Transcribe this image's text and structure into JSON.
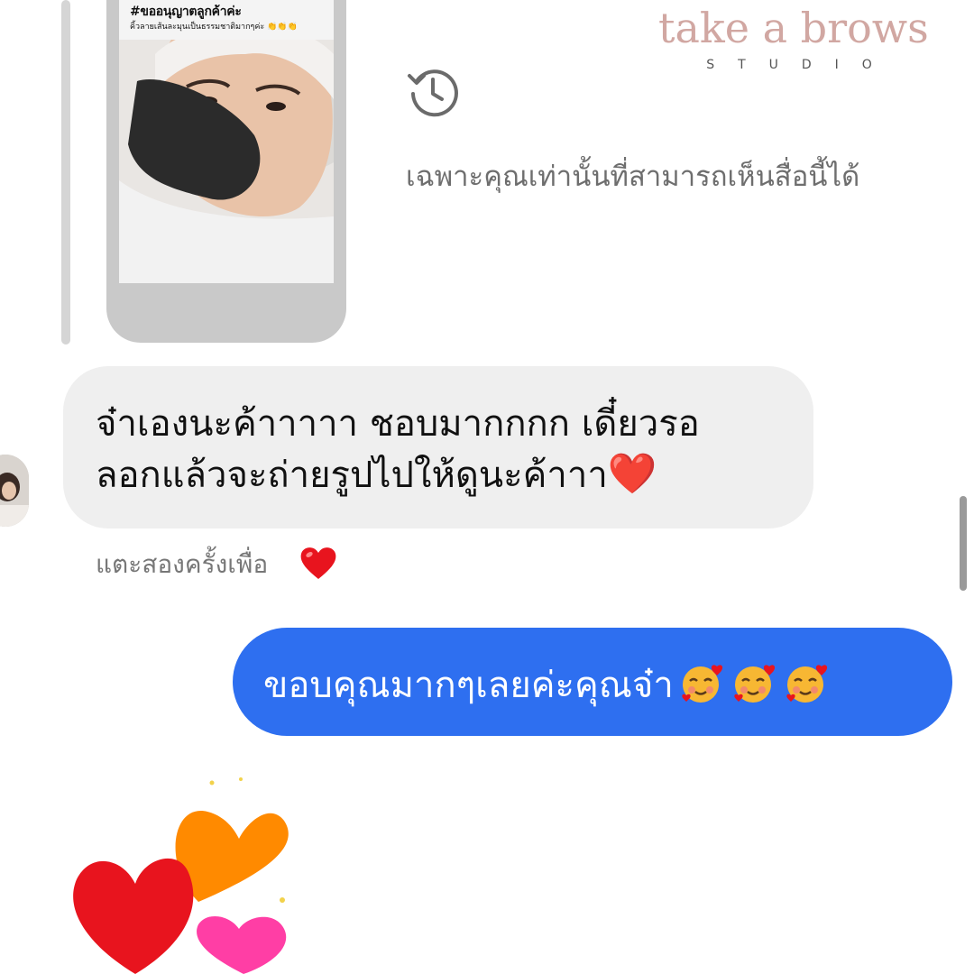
{
  "story": {
    "caption_title": "#ขออนุญาตลูกค้าค่ะ",
    "caption_sub": "คิ้วลายเส้นละมุนเป็นธรรมชาติมากๆค่ะ 👏👏👏"
  },
  "brand": {
    "name": "take a brows",
    "sub": "STUDIO"
  },
  "notice": {
    "only_you_text": "เฉพาะคุณเท่านั้นที่สามารถเห็นสื่อนี้ได้"
  },
  "incoming_message": {
    "line1": "จ๋าเองนะค้าาาาา ชอบมากกกก เดี๋ยวรอ",
    "line2": "ลอกแล้วจะถ่ายรูปไปให้ดูนะค้าาา",
    "emoji": "❤️"
  },
  "tap_hint": {
    "text": "แตะสองครั้งเพื่อ",
    "emoji": "❤️"
  },
  "outgoing_message": {
    "text": "ขอบคุณมากๆเลยค่ะคุณจ๋า",
    "emojis": [
      "🥰",
      "🥰",
      "🥰"
    ]
  },
  "colors": {
    "outgoing_bubble": "#2e6ff0",
    "incoming_bubble": "#efefef",
    "brand": "#d1a7a2"
  },
  "icons": [
    "history-icon",
    "heart-icon",
    "smiling-face-with-hearts-icon",
    "hearts-sticker"
  ]
}
